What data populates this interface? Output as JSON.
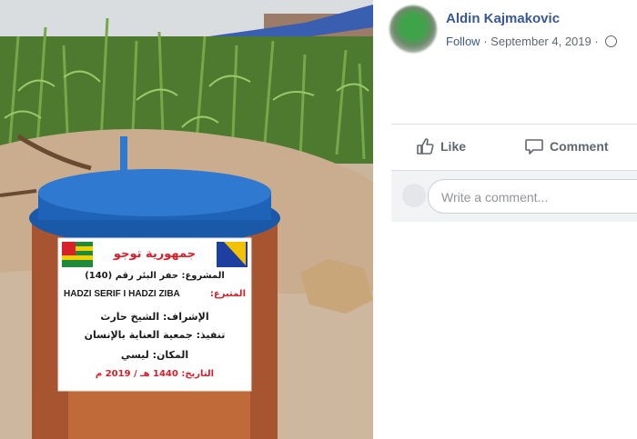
{
  "post": {
    "author": "Aldin Kajmakovic",
    "follow_label": "Follow",
    "separator": "·",
    "date": "September 4, 2019"
  },
  "actions": {
    "like_label": "Like",
    "comment_label": "Comment"
  },
  "comment_box": {
    "placeholder": "Write a comment..."
  },
  "sign": {
    "title": "جمهورية توجو",
    "line1": "المشروع: حفر البئر رقم (140)",
    "donor_label": "المتبرع:",
    "donor_name": "HADZI SERIF I HADZI ZIBA",
    "line3": "الإشراف: الشيخ حارث",
    "line4": "تنفيذ: جمعية العناية بالإنسان",
    "line5": "المكان: ليسي",
    "line6": "التاريخ: 1440 هـ / 2019 م"
  },
  "colors": {
    "link": "#385898",
    "meta_text": "#616770",
    "lid_blue": "#1e63b8",
    "tank_orange": "#c06a3a",
    "sign_red": "#d8202a"
  }
}
